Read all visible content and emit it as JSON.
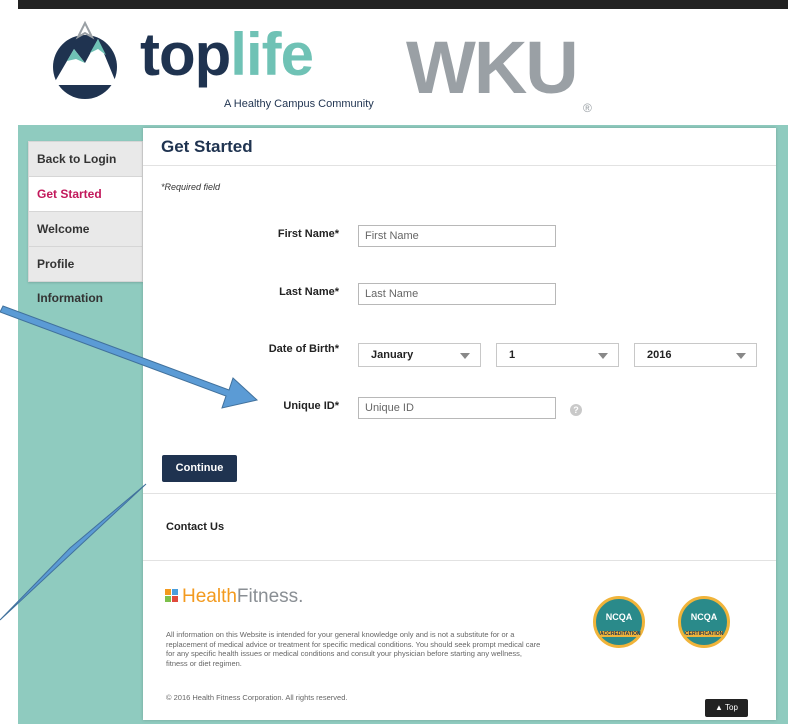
{
  "header": {
    "logo_top_part1": "top",
    "logo_top_part2": "life",
    "logo_tagline": "A Healthy Campus Community",
    "logo_wku": "WKU",
    "logo_wku_reg": "®"
  },
  "sidebar": {
    "items": [
      {
        "label": "Back to Login"
      },
      {
        "label": "Get Started",
        "active": true
      },
      {
        "label": "Welcome"
      },
      {
        "label": "Profile Information"
      }
    ]
  },
  "form": {
    "title": "Get Started",
    "required_note": "*Required field",
    "first_name": {
      "label": "First Name*",
      "placeholder": "First Name"
    },
    "last_name": {
      "label": "Last Name*",
      "placeholder": "Last Name"
    },
    "dob": {
      "label": "Date of Birth*",
      "month": "January",
      "day": "1",
      "year": "2016"
    },
    "unique_id": {
      "label": "Unique ID*",
      "placeholder": "Unique ID",
      "help": "?"
    },
    "continue_label": "Continue"
  },
  "footer": {
    "contact": "Contact Us",
    "hf_logo_part1": "Health",
    "hf_logo_part2": "Fitness.",
    "disclaimer": "All information on this Website is intended for your general knowledge only and is not a substitute for or a replacement of medical advice or treatment for specific medical conditions. You should seek prompt medical care for any specific health issues or medical conditions and consult your physician before starting any wellness, fitness or diet regimen.",
    "copyright": "© 2016 Health Fitness Corporation. All rights reserved.",
    "badge1": {
      "title": "NCQA",
      "text": "ACCREDITATION"
    },
    "badge2": {
      "title": "NCQA",
      "text": "CERTIFICATION"
    },
    "top_label": "▲ Top"
  },
  "colors": {
    "navy": "#1f3350",
    "teal": "#8fcbbf",
    "active": "#c2185b",
    "arrow": "#5b9bd5"
  }
}
